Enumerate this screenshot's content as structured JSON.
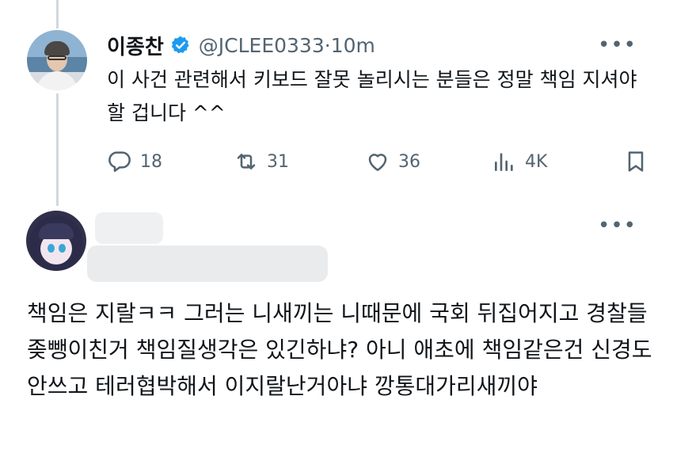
{
  "tweet": {
    "display_name": "이종찬",
    "handle": "@JCLEE0333",
    "separator": " · ",
    "time": "10m",
    "text": "이 사건 관련해서 키보드 잘못 놀리시는 분들은 정말 책임 지셔야 할 겁니다 ^^",
    "more": "•••",
    "stats": {
      "replies": "18",
      "retweets": "31",
      "likes": "36",
      "views": "4K"
    },
    "verified_color": "#1d9bf0"
  },
  "reply": {
    "more": "•••",
    "text": "책임은 지랄ㅋㅋ 그러는 니새끼는 니때문에 국회 뒤집어지고 경찰들 좆뺑이친거 책임질생각은 있긴하냐? 아니 애초에 책임같은건 신경도 안쓰고 테러협박해서 이지랄난거아냐 깡통대가리새끼야"
  },
  "icons": {
    "reply": "speech-bubble-icon",
    "retweet": "retweet-arrows-icon",
    "like": "heart-icon",
    "views": "bar-chart-icon",
    "bookmark": "bookmark-icon",
    "verified": "verified-badge-icon",
    "more": "more-dots-icon"
  }
}
